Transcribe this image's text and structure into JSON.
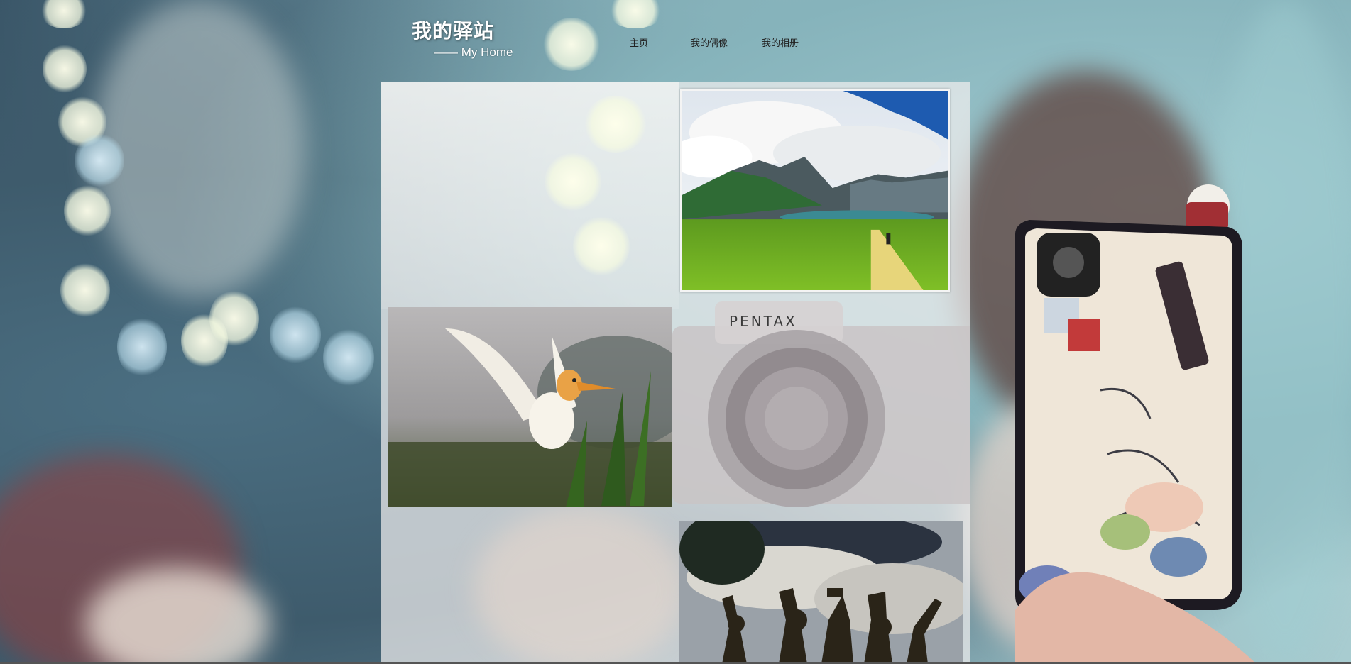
{
  "header": {
    "title": "我的驿站",
    "subtitle": "—— My Home"
  },
  "nav": {
    "items": [
      {
        "label": "主页"
      },
      {
        "label": "我的偶像"
      },
      {
        "label": "我的相册"
      }
    ]
  },
  "gallery": {
    "photos": [
      {
        "subject": "mountain-lake-landscape"
      },
      {
        "subject": "egret-bird-in-flight"
      },
      {
        "subject": "crowd-silhouettes-fireworks"
      }
    ]
  },
  "colors": {
    "background_accent": "#8fb6be",
    "panel": "#f0eeee",
    "nav_text": "#222222",
    "title_text": "#ffffff"
  }
}
